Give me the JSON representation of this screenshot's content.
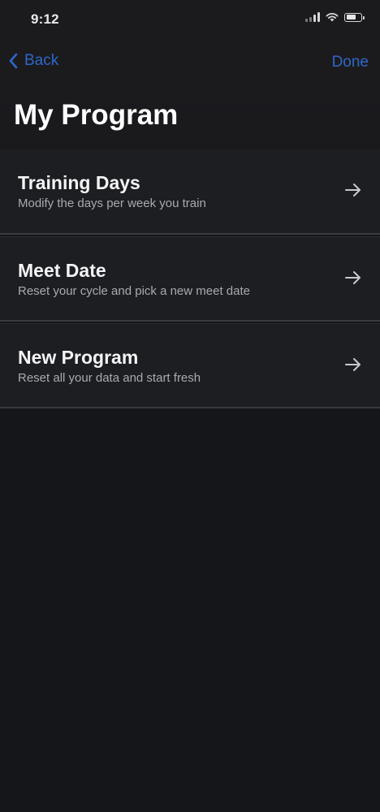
{
  "status_bar": {
    "time": "9:12",
    "icons": [
      "cellular-signal-icon",
      "wifi-icon",
      "battery-icon"
    ]
  },
  "nav": {
    "back_label": "Back",
    "done_label": "Done",
    "back_icon": "chevron-left-icon"
  },
  "page": {
    "title": "My Program"
  },
  "items": [
    {
      "title": "Training Days",
      "subtitle": "Modify the days per week you train",
      "icon": "arrow-right-icon"
    },
    {
      "title": "Meet Date",
      "subtitle": "Reset your cycle and pick a new meet date",
      "icon": "arrow-right-icon"
    },
    {
      "title": "New Program",
      "subtitle": "Reset all your data and start fresh",
      "icon": "arrow-right-icon"
    }
  ],
  "colors": {
    "background": "#151619",
    "accent": "#2f67c8",
    "row_background": "#1d1e22",
    "subtitle": "#a9aab0"
  }
}
